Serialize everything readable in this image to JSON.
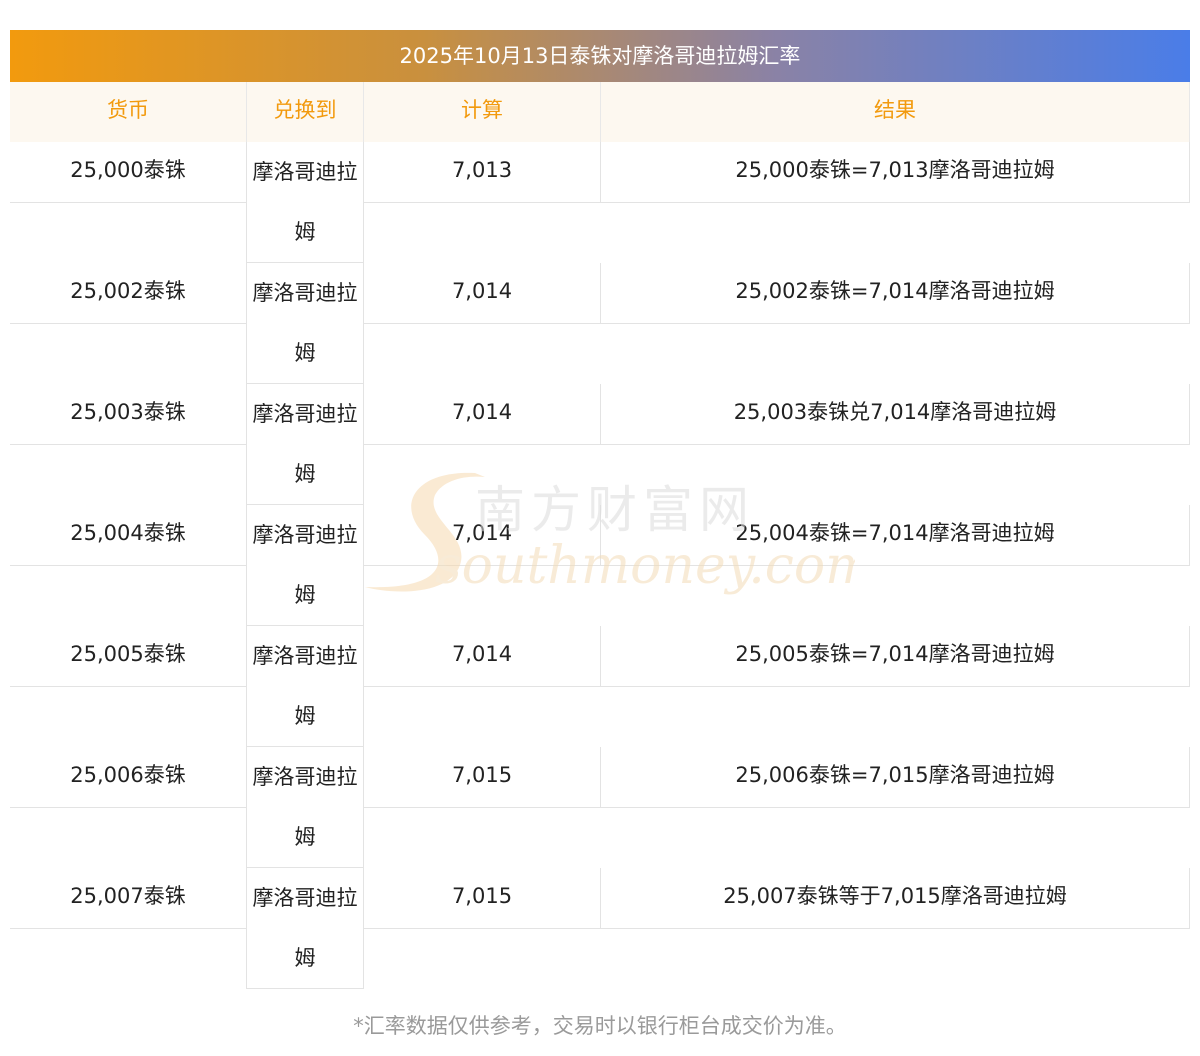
{
  "title": "2025年10月13日泰铢对摩洛哥迪拉姆汇率",
  "headers": {
    "currency": "货币",
    "convert_to": "兑换到",
    "calc": "计算",
    "result": "结果"
  },
  "rows": [
    {
      "currency": "25,000泰铢",
      "convert_to": "摩洛哥迪拉姆",
      "calc": "7,013",
      "result": "25,000泰铢=7,013摩洛哥迪拉姆"
    },
    {
      "currency": "25,002泰铢",
      "convert_to": "摩洛哥迪拉姆",
      "calc": "7,014",
      "result": "25,002泰铢=7,014摩洛哥迪拉姆"
    },
    {
      "currency": "25,003泰铢",
      "convert_to": "摩洛哥迪拉姆",
      "calc": "7,014",
      "result": "25,003泰铢兑7,014摩洛哥迪拉姆"
    },
    {
      "currency": "25,004泰铢",
      "convert_to": "摩洛哥迪拉姆",
      "calc": "7,014",
      "result": "25,004泰铢=7,014摩洛哥迪拉姆"
    },
    {
      "currency": "25,005泰铢",
      "convert_to": "摩洛哥迪拉姆",
      "calc": "7,014",
      "result": "25,005泰铢=7,014摩洛哥迪拉姆"
    },
    {
      "currency": "25,006泰铢",
      "convert_to": "摩洛哥迪拉姆",
      "calc": "7,015",
      "result": "25,006泰铢=7,015摩洛哥迪拉姆"
    },
    {
      "currency": "25,007泰铢",
      "convert_to": "摩洛哥迪拉姆",
      "calc": "7,015",
      "result": "25,007泰铢等于7,015摩洛哥迪拉姆"
    }
  ],
  "watermark": {
    "cn": "南方财富网",
    "en": "southmoney.com"
  },
  "footnote": "*汇率数据仅供参考，交易时以银行柜台成交价为准。",
  "colors": {
    "accent": "#f29a0e",
    "gradient_end": "#4a7de8",
    "header_bg": "#fdf8f0",
    "footnote": "#9a9a9a"
  }
}
